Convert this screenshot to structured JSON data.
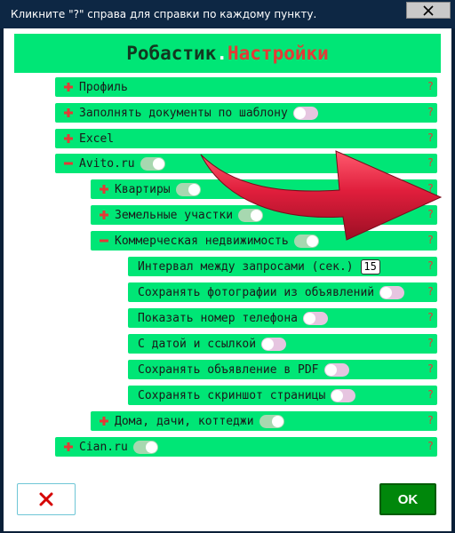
{
  "window": {
    "title": "Кликните \"?\" справа для справки по каждому пункту."
  },
  "banner": {
    "app_name": "Робастик",
    "separator": ".",
    "section": "Настройки"
  },
  "rows": [
    {
      "id": "profile",
      "expand": "+",
      "label": "Профиль",
      "toggle": null,
      "help": "?"
    },
    {
      "id": "fill-docs",
      "expand": "+",
      "label": "Заполнять документы по шаблону",
      "toggle": "off",
      "help": "?"
    },
    {
      "id": "excel",
      "expand": "+",
      "label": "Excel",
      "toggle": null,
      "help": "?"
    },
    {
      "id": "avito",
      "expand": "−",
      "label": "Avito.ru",
      "toggle": "on",
      "help": "?"
    },
    {
      "id": "apartments",
      "expand": "+",
      "label": "Квартиры",
      "toggle": "on",
      "help": "?"
    },
    {
      "id": "land",
      "expand": "+",
      "label": "Земельные участки",
      "toggle": "on",
      "help": "?"
    },
    {
      "id": "commercial",
      "expand": "−",
      "label": "Коммерческая недвижимость",
      "toggle": "on",
      "help": "?"
    },
    {
      "id": "interval",
      "expand": "",
      "label": "Интервал между запросами (сек.)",
      "toggle": null,
      "value": "15",
      "help": "?"
    },
    {
      "id": "save-photos",
      "expand": "",
      "label": "Сохранять фотографии из объявлений",
      "toggle": "off",
      "help": "?"
    },
    {
      "id": "show-phone",
      "expand": "",
      "label": "Показать номер телефона",
      "toggle": "off",
      "help": "?"
    },
    {
      "id": "date-link",
      "expand": "",
      "label": "С датой и ссылкой",
      "toggle": "off",
      "help": "?"
    },
    {
      "id": "save-pdf",
      "expand": "",
      "label": "Сохранять объявление в PDF",
      "toggle": "off",
      "help": "?"
    },
    {
      "id": "save-screenshot",
      "expand": "",
      "label": "Сохранять скриншот страницы",
      "toggle": "off",
      "help": "?"
    },
    {
      "id": "houses",
      "expand": "+",
      "label": "Дома, дачи, коттеджи",
      "toggle": "on",
      "help": "?"
    },
    {
      "id": "cian",
      "expand": "+",
      "label": "Cian.ru",
      "toggle": "on",
      "help": "?"
    }
  ],
  "buttons": {
    "cancel_icon": "close-icon",
    "ok_label": "OK"
  },
  "colors": {
    "row_bg": "#00e676",
    "help_mark": "#e53935",
    "toggle_on": "#a7d8b0",
    "toggle_off": "#e6c5e0",
    "ok_bg": "#00870b",
    "arrow": "#d81b36"
  }
}
